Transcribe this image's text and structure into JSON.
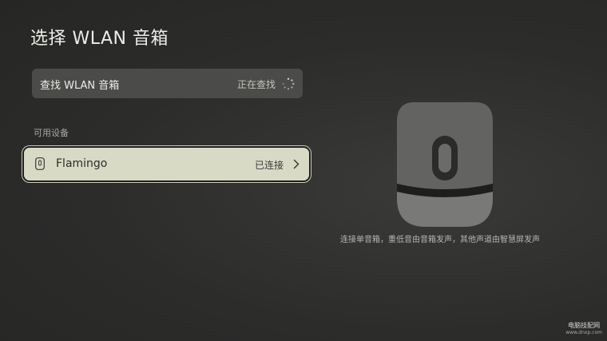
{
  "page": {
    "title": "选择 WLAN 音箱"
  },
  "search": {
    "label": "查找 WLAN 音箱",
    "status": "正在查找",
    "spinner_icon": "loading-spinner-icon"
  },
  "available": {
    "section_label": "可用设备",
    "devices": [
      {
        "name": "Flamingo",
        "status": "已连接",
        "icon": "speaker-icon",
        "selected": true
      }
    ]
  },
  "illustration": {
    "icon": "smart-speaker-illustration",
    "caption": "连接单音箱，重低音由音箱发声，其他声道由智慧屏发声"
  },
  "watermark": {
    "main": "电脑技配网",
    "sub": "www.dnxp.com"
  },
  "colors": {
    "background": "#2c2c2b",
    "row_bg": "#4b4b49",
    "selected_bg": "#d9dac6"
  }
}
